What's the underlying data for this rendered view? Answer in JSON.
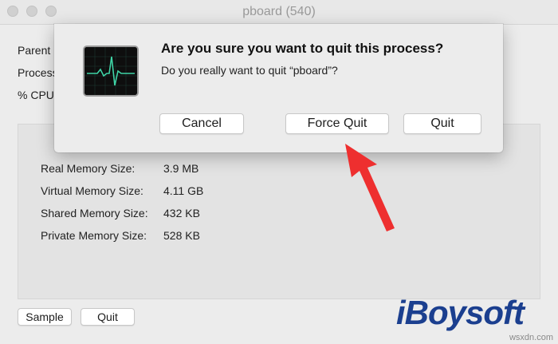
{
  "window": {
    "title": "pboard (540)"
  },
  "info_labels": {
    "parent": "Parent",
    "process": "Process",
    "cpu": "% CPU:"
  },
  "memory": [
    {
      "label": "Real Memory Size:",
      "value": "3.9 MB"
    },
    {
      "label": "Virtual Memory Size:",
      "value": "4.11 GB"
    },
    {
      "label": "Shared Memory Size:",
      "value": "432 KB"
    },
    {
      "label": "Private Memory Size:",
      "value": "528 KB"
    }
  ],
  "bottom_buttons": {
    "sample": "Sample",
    "quit": "Quit"
  },
  "dialog": {
    "title": "Are you sure you want to quit this process?",
    "message": "Do you really want to quit “pboard”?",
    "cancel": "Cancel",
    "force_quit": "Force Quit",
    "quit": "Quit"
  },
  "watermark": {
    "brand": "iBoysoft",
    "site": "wsxdn.com"
  },
  "colors": {
    "arrow": "#ee2f2f",
    "brand": "#1b3f8f",
    "monitor_line": "#3fd4a6"
  },
  "icons": {
    "dialog_icon": "activity-monitor-icon",
    "annotation": "red-arrow-icon"
  }
}
